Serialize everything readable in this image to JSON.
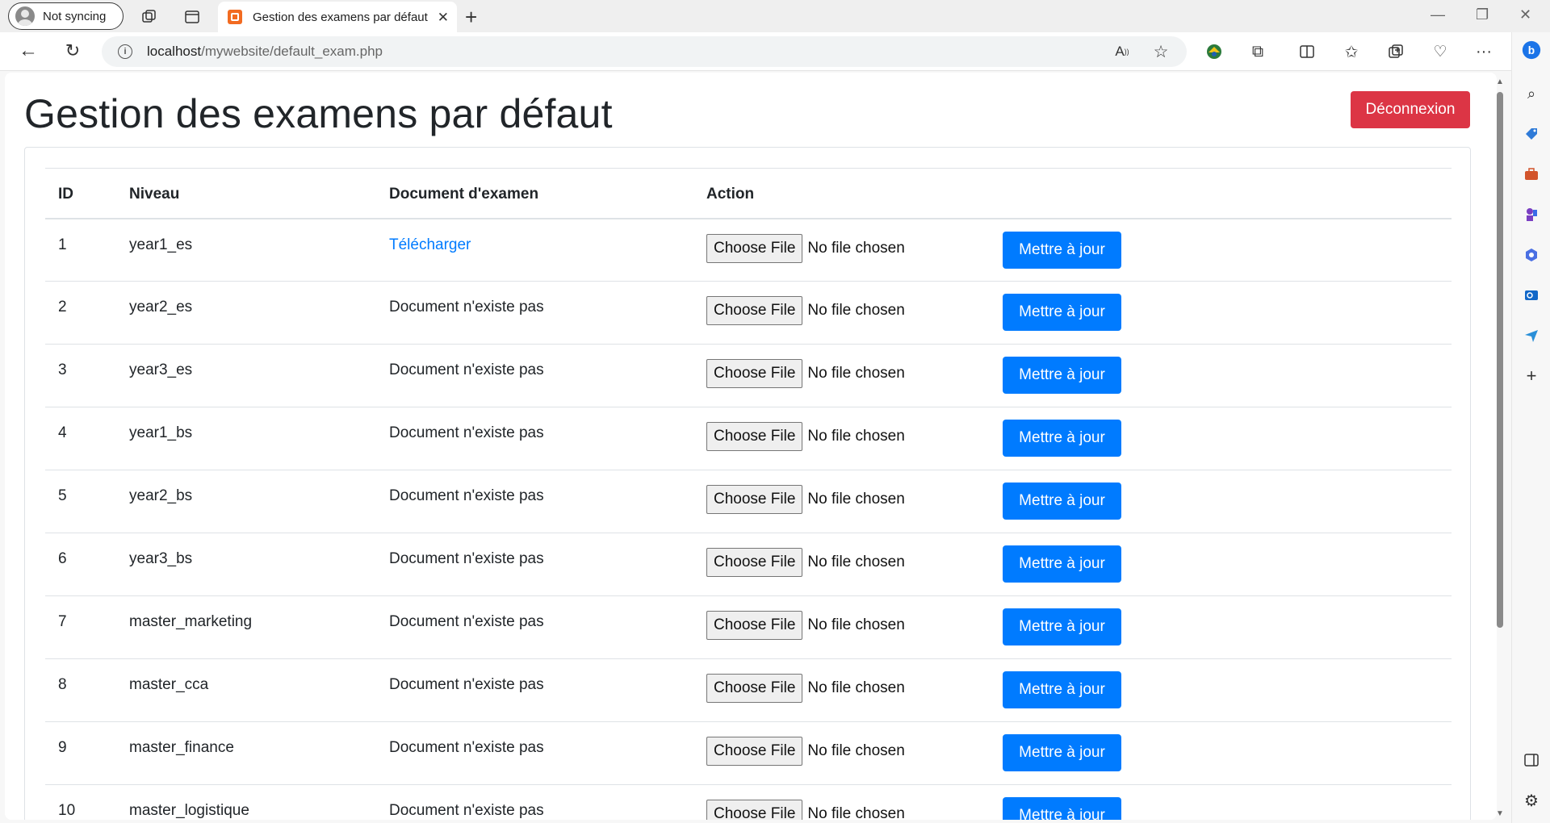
{
  "browser": {
    "profile_label": "Not syncing",
    "tab_title": "Gestion des examens par défaut",
    "url_host": "localhost",
    "url_path": "/mywebsite/default_exam.php"
  },
  "icons": {
    "workspaces": "workspaces-icon",
    "tab_actions": "tab-actions-icon",
    "close": "close-icon",
    "new_tab": "plus-icon",
    "back": "back-arrow-icon",
    "reload": "reload-icon",
    "read_aloud": "read-aloud-icon",
    "favorite": "star-icon",
    "extensions": "puzzle-icon",
    "split_screen": "split-screen-icon",
    "favorites_bar": "favorites-icon",
    "collections": "collections-icon",
    "health": "browser-essentials-icon",
    "more": "more-icon",
    "copilot": "copilot-icon"
  },
  "page": {
    "title": "Gestion des examens par défaut",
    "logout_label": "Déconnexion"
  },
  "table": {
    "headers": [
      "ID",
      "Niveau",
      "Document d'examen",
      "Action"
    ],
    "choose_file_label": "Choose File",
    "no_file_label": "No file chosen",
    "update_label": "Mettre à jour",
    "rows": [
      {
        "id": "1",
        "niveau": "year1_es",
        "document": "Télécharger",
        "is_link": true
      },
      {
        "id": "2",
        "niveau": "year2_es",
        "document": "Document n'existe pas",
        "is_link": false
      },
      {
        "id": "3",
        "niveau": "year3_es",
        "document": "Document n'existe pas",
        "is_link": false
      },
      {
        "id": "4",
        "niveau": "year1_bs",
        "document": "Document n'existe pas",
        "is_link": false
      },
      {
        "id": "5",
        "niveau": "year2_bs",
        "document": "Document n'existe pas",
        "is_link": false
      },
      {
        "id": "6",
        "niveau": "year3_bs",
        "document": "Document n'existe pas",
        "is_link": false
      },
      {
        "id": "7",
        "niveau": "master_marketing",
        "document": "Document n'existe pas",
        "is_link": false
      },
      {
        "id": "8",
        "niveau": "master_cca",
        "document": "Document n'existe pas",
        "is_link": false
      },
      {
        "id": "9",
        "niveau": "master_finance",
        "document": "Document n'existe pas",
        "is_link": false
      },
      {
        "id": "10",
        "niveau": "master_logistique",
        "document": "Document n'existe pas",
        "is_link": false
      }
    ]
  },
  "colors": {
    "primary": "#007bff",
    "danger": "#dc3545",
    "border": "#dee2e6"
  }
}
